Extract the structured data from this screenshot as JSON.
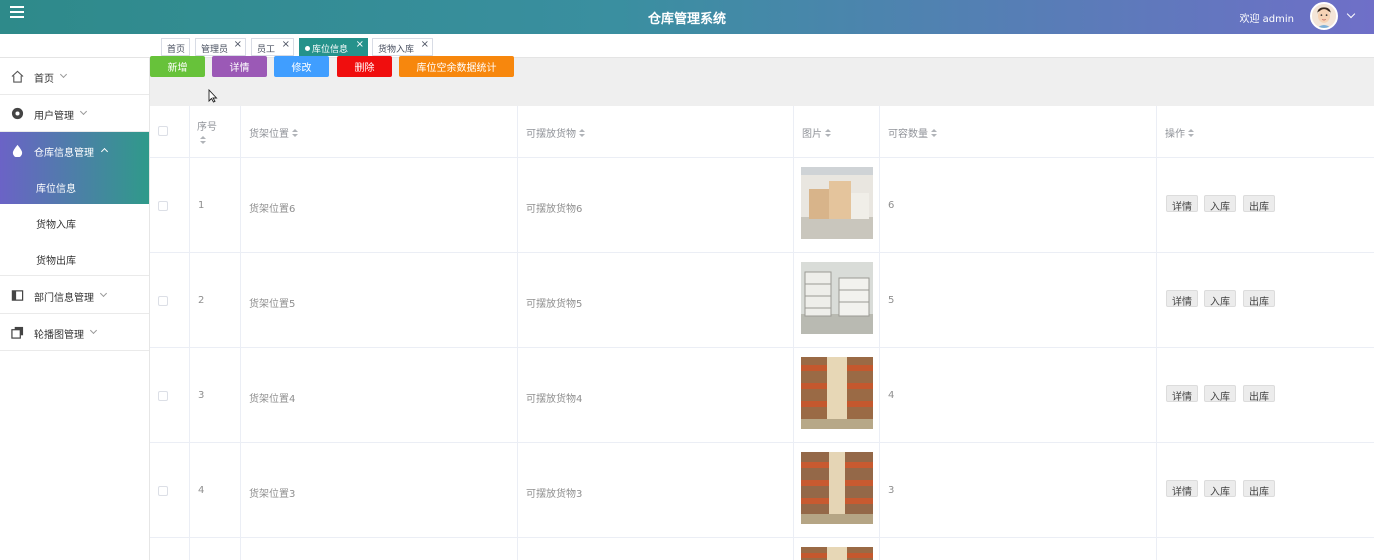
{
  "header": {
    "app_title": "仓库管理系统",
    "welcome": "欢迎 admin"
  },
  "tabs": [
    {
      "label": "首页",
      "closable": false,
      "active": false
    },
    {
      "label": "管理员",
      "closable": true,
      "active": false
    },
    {
      "label": "员工",
      "closable": true,
      "active": false
    },
    {
      "label": "库位信息",
      "closable": true,
      "active": true
    },
    {
      "label": "货物入库",
      "closable": true,
      "active": false
    }
  ],
  "tab_close": "×",
  "sidebar": {
    "items": [
      {
        "label": "首页",
        "icon": "home-icon"
      },
      {
        "label": "用户管理",
        "icon": "user-circle-icon"
      },
      {
        "label": "仓库信息管理",
        "icon": "drop-icon",
        "open": true
      },
      {
        "label": "部门信息管理",
        "icon": "panel-icon"
      },
      {
        "label": "轮播图管理",
        "icon": "copy-icon"
      }
    ],
    "sub_items": [
      {
        "label": "库位信息",
        "active": true
      },
      {
        "label": "货物入库",
        "active": false
      },
      {
        "label": "货物出库",
        "active": false
      }
    ]
  },
  "toolbar": {
    "add": "新增",
    "detail": "详情",
    "edit": "修改",
    "delete": "删除",
    "stats": "库位空余数据统计"
  },
  "colors": {
    "add": "#67c23a",
    "detail": "#9b59b6",
    "edit": "#409eff",
    "delete": "#f00e0e",
    "stats": "#f7870d",
    "accent": "#25928b"
  },
  "table": {
    "columns": [
      "序号",
      "货架位置",
      "可摆放货物",
      "图片",
      "可容数量",
      "操作"
    ],
    "rows": [
      {
        "index": "1",
        "location": "货架位置6",
        "goods": "可摆放货物6",
        "capacity": "6"
      },
      {
        "index": "2",
        "location": "货架位置5",
        "goods": "可摆放货物5",
        "capacity": "5"
      },
      {
        "index": "3",
        "location": "货架位置4",
        "goods": "可摆放货物4",
        "capacity": "4"
      },
      {
        "index": "4",
        "location": "货架位置3",
        "goods": "可摆放货物3",
        "capacity": "3"
      }
    ],
    "row_actions": [
      "详情",
      "入库",
      "出库"
    ]
  }
}
